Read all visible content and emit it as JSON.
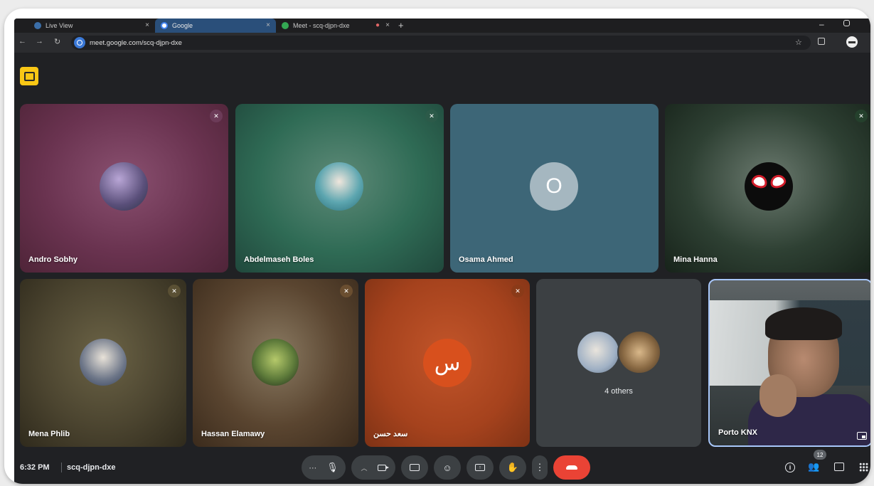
{
  "browser": {
    "tabs": [
      {
        "title": "Live View",
        "color": "#3b6ea8"
      },
      {
        "title": "Google",
        "color": "#4285f4",
        "active": true
      },
      {
        "title": "Meet - scq-djpn-dxe",
        "color": "#34a853"
      }
    ],
    "new_tab_icon": "plus-icon",
    "url": "meet.google.com/scq-djpn-dxe"
  },
  "meet": {
    "participants": [
      {
        "name": "Andro Sobhy",
        "muted": true
      },
      {
        "name": "Abdelmaseh Boles",
        "muted": true
      },
      {
        "name": "Osama Ahmed",
        "initial": "O"
      },
      {
        "name": "Mina Hanna",
        "muted": true
      },
      {
        "name": "Mena Phlib",
        "muted": true
      },
      {
        "name": "Hassan Elamawy",
        "muted": true
      },
      {
        "name": "سعد حسن",
        "initial": "س",
        "muted": true
      },
      {
        "name": "Porto KNX"
      }
    ],
    "others_label": "4 others",
    "time": "6:32 PM",
    "meeting_code": "scq-djpn-dxe",
    "participant_count": "12",
    "colors": {
      "accent": "#a8c7fa",
      "leave": "#ea4335",
      "recording": "#f9c715"
    }
  }
}
